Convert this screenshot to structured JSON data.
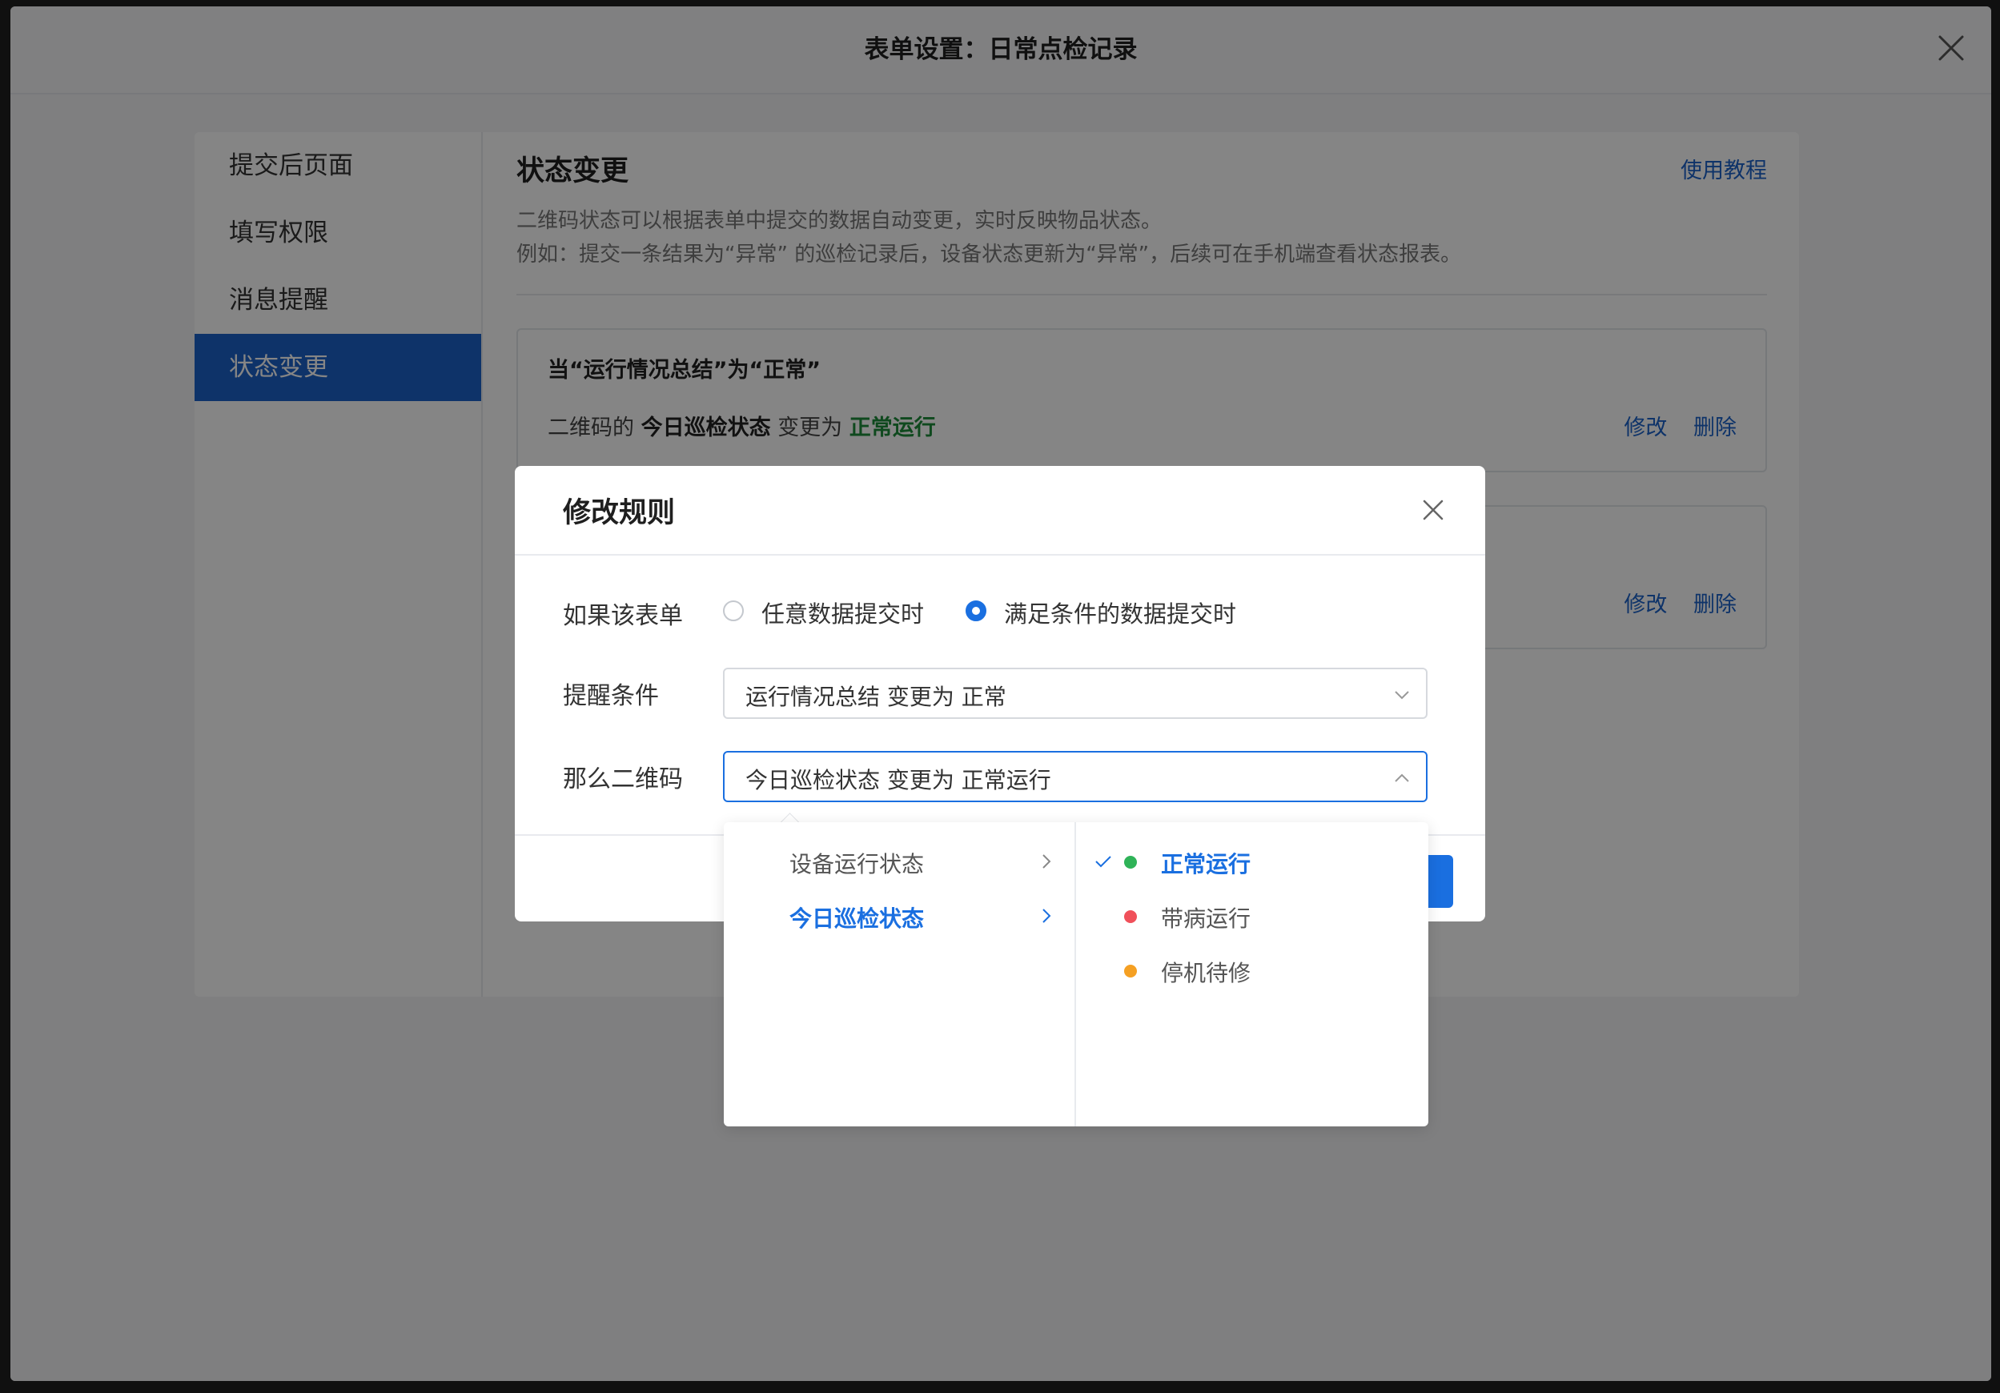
{
  "window": {
    "title": "表单设置：日常点检记录"
  },
  "sidebar": {
    "items": [
      {
        "label": "提交后页面"
      },
      {
        "label": "填写权限"
      },
      {
        "label": "消息提醒"
      },
      {
        "label": "状态变更"
      }
    ]
  },
  "section": {
    "title": "状态变更",
    "tutorial_link": "使用教程",
    "desc_line1": "二维码状态可以根据表单中提交的数据自动变更，实时反映物品状态。",
    "desc_line2": "例如：提交一条结果为“异常” 的巡检记录后，设备状态更新为“异常”，后续可在手机端查看状态报表。"
  },
  "rules": [
    {
      "condition": "当“运行情况总结”为“正常”",
      "action_prefix": "二维码的",
      "field": "今日巡检状态",
      "action_mid": "变更为",
      "value": "正常运行",
      "edit": "修改",
      "delete": "删除"
    },
    {
      "edit": "修改",
      "delete": "删除"
    }
  ],
  "modal": {
    "title": "修改规则",
    "if_label": "如果该表单",
    "radio_any": "任意数据提交时",
    "radio_cond": "满足条件的数据提交时",
    "cond_label": "提醒条件",
    "cond_value": "运行情况总结 变更为 正常",
    "then_label": "那么二维码",
    "then_value": "今日巡检状态 变更为 正常运行"
  },
  "dropdown": {
    "fields": [
      {
        "label": "设备运行状态"
      },
      {
        "label": "今日巡检状态"
      }
    ],
    "options": [
      {
        "label": "正常运行",
        "color": "#2fb358"
      },
      {
        "label": "带病运行",
        "color": "#f0505a"
      },
      {
        "label": "停机待修",
        "color": "#f5a023"
      }
    ]
  },
  "colors": {
    "accent": "#1a6fe0",
    "sidebar_active": "#1b62c9",
    "success": "#1e8c3a"
  }
}
